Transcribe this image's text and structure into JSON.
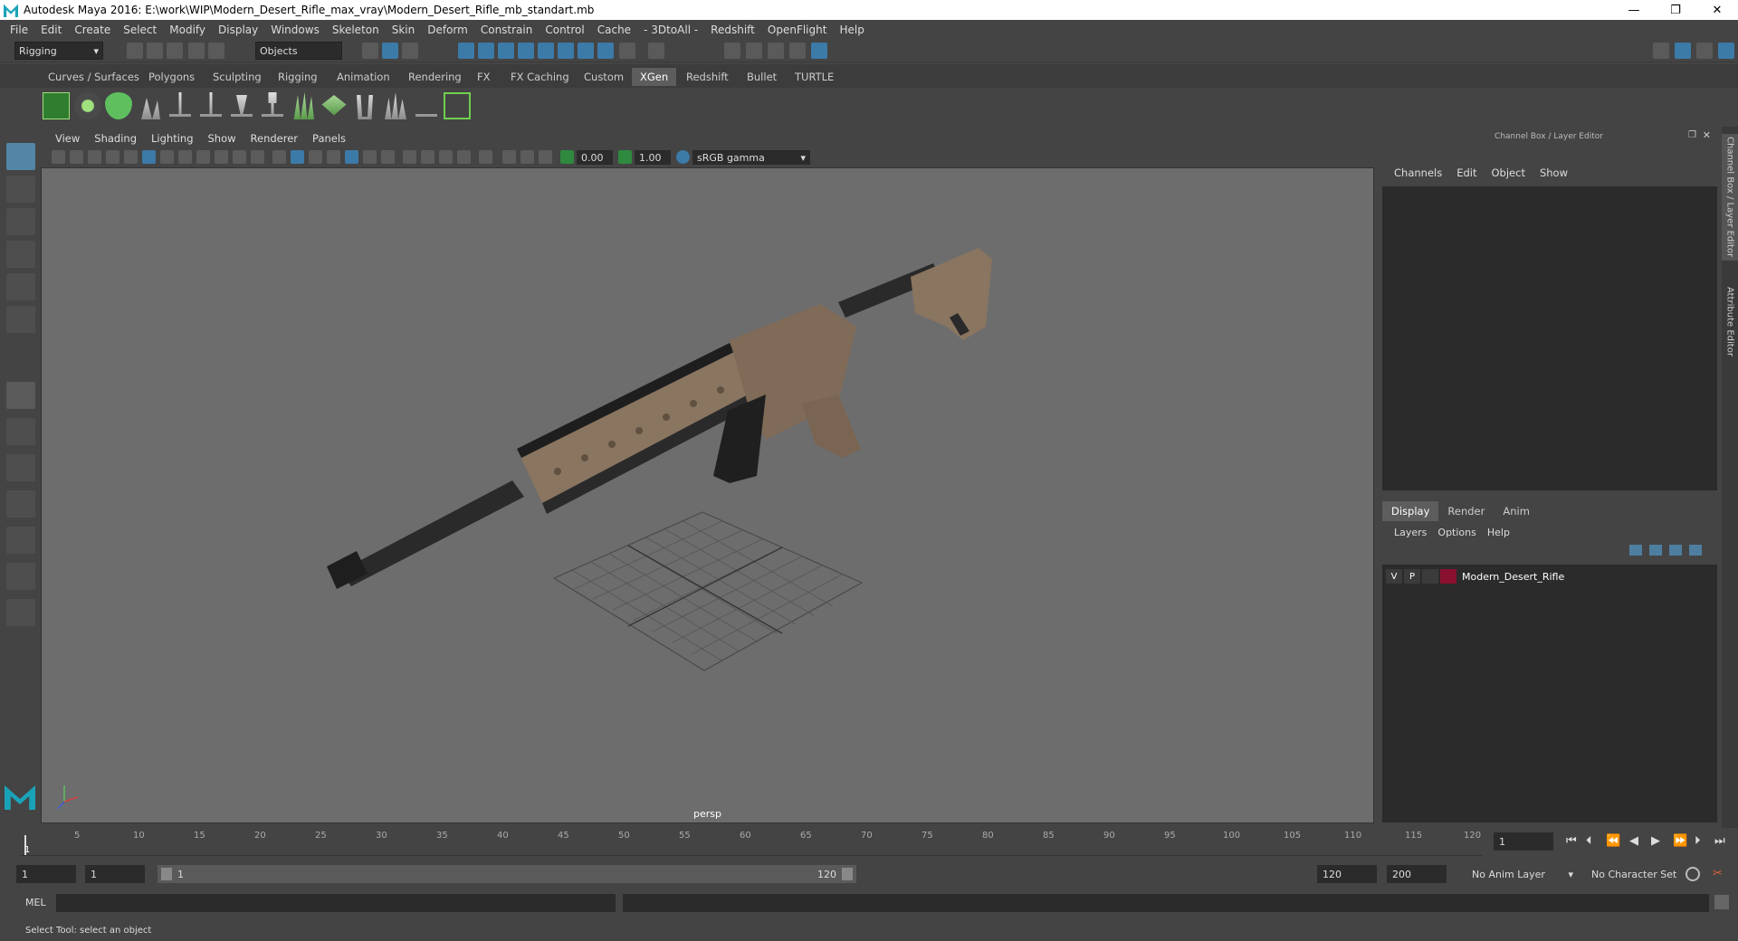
{
  "window": {
    "title": "Autodesk Maya 2016: E:\\work\\WIP\\Modern_Desert_Rifle_max_vray\\Modern_Desert_Rifle_mb_standart.mb",
    "minimize": "—",
    "restore": "❐",
    "close": "✕"
  },
  "menubar": [
    "File",
    "Edit",
    "Create",
    "Select",
    "Modify",
    "Display",
    "Windows",
    "Skeleton",
    "Skin",
    "Deform",
    "Constrain",
    "Control",
    "Cache",
    "- 3DtoAll -",
    "Redshift",
    "OpenFlight",
    "Help"
  ],
  "statusline": {
    "mode": "Rigging",
    "select_mode": "Objects"
  },
  "shelf_tabs": [
    "Curves / Surfaces",
    "Polygons",
    "Sculpting",
    "Rigging",
    "Animation",
    "Rendering",
    "FX",
    "FX Caching",
    "Custom",
    "XGen",
    "Redshift",
    "Bullet",
    "TURTLE"
  ],
  "active_shelf_tab": "XGen",
  "viewport": {
    "menu": [
      "View",
      "Shading",
      "Lighting",
      "Show",
      "Renderer",
      "Panels"
    ],
    "exposure": "0.00",
    "gamma": "1.00",
    "color_space": "sRGB gamma",
    "camera_label": "persp"
  },
  "right_panel": {
    "title": "Channel Box / Layer Editor",
    "channel_menu": [
      "Channels",
      "Edit",
      "Object",
      "Show"
    ],
    "layer_tabs": [
      "Display",
      "Render",
      "Anim"
    ],
    "active_layer_tab": "Display",
    "layer_menu": [
      "Layers",
      "Options",
      "Help"
    ],
    "layers": [
      {
        "v": "V",
        "p": "P",
        "color": "#8a1030",
        "name": "Modern_Desert_Rifle"
      }
    ],
    "side_tabs": [
      "Channel Box / Layer Editor",
      "Attribute Editor"
    ]
  },
  "timeline": {
    "ticks": [
      "1",
      "5",
      "10",
      "15",
      "20",
      "25",
      "30",
      "35",
      "40",
      "45",
      "50",
      "55",
      "60",
      "65",
      "70",
      "75",
      "80",
      "85",
      "90",
      "95",
      "100",
      "105",
      "110",
      "115",
      "120"
    ],
    "current_frame": "1"
  },
  "range": {
    "start": "1",
    "playback_start": "1",
    "slider_start": "1",
    "slider_end": "120",
    "playback_end": "120",
    "end": "200",
    "anim_layer": "No Anim Layer",
    "character_set": "No Character Set"
  },
  "command_line": {
    "label": "MEL"
  },
  "help_line": "Select Tool: select an object"
}
